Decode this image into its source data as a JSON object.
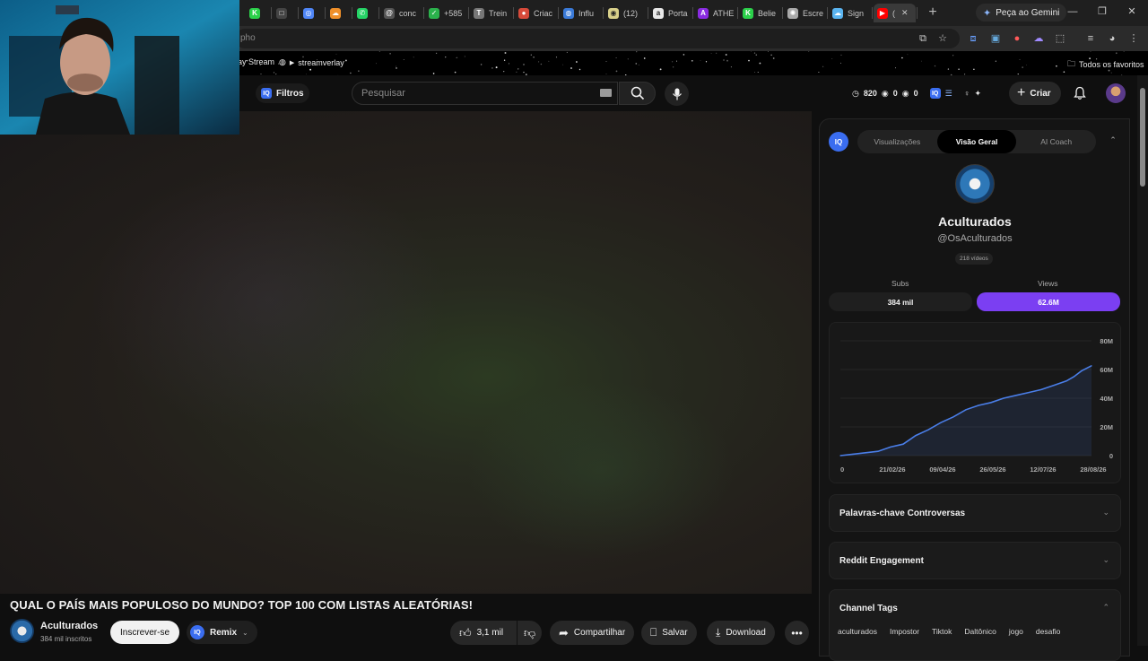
{
  "browser": {
    "tabs": [
      {
        "label": "",
        "icon": "kiwi-icon",
        "color": "#2bd14a",
        "glyph": "K"
      },
      {
        "label": "",
        "icon": "app-icon",
        "color": "#444444",
        "glyph": "□"
      },
      {
        "label": "",
        "icon": "globe-icon",
        "color": "#4f86f7",
        "glyph": "◎"
      },
      {
        "label": "",
        "icon": "cloud-icon",
        "color": "#f0902a",
        "glyph": "☁"
      },
      {
        "label": "",
        "icon": "whatsapp-icon",
        "color": "#25d366",
        "glyph": "✆"
      },
      {
        "label": "conc",
        "icon": "threads-icon",
        "color": "#555555",
        "glyph": "@"
      },
      {
        "label": "+585",
        "icon": "check-icon",
        "color": "#2bb24c",
        "glyph": "✓"
      },
      {
        "label": "Trein",
        "icon": "doc-icon",
        "color": "#777777",
        "glyph": "T"
      },
      {
        "label": "Criac",
        "icon": "record-icon",
        "color": "#d84a3a",
        "glyph": "●"
      },
      {
        "label": "Influ",
        "icon": "globe-icon",
        "color": "#3a7ad8",
        "glyph": "◍"
      },
      {
        "label": "(12)",
        "icon": "chat-icon",
        "color": "#d8d08a",
        "glyph": "◉"
      },
      {
        "label": "Porta",
        "icon": "amazon-icon",
        "color": "#e8e8e8",
        "glyph": "a"
      },
      {
        "label": "ATHE",
        "icon": "athena-icon",
        "color": "#8a2be2",
        "glyph": "A"
      },
      {
        "label": "Belie",
        "icon": "kiwi-icon",
        "color": "#2bd14a",
        "glyph": "K"
      },
      {
        "label": "Escre",
        "icon": "openai-icon",
        "color": "#aaaaaa",
        "glyph": "✺"
      },
      {
        "label": "Sign",
        "icon": "cloud-icon",
        "color": "#5ab4f0",
        "glyph": "☁"
      },
      {
        "label": "(",
        "icon": "youtube-icon",
        "color": "#ff0000",
        "glyph": "▶"
      }
    ],
    "gemini_label": "Peça ao Gemini",
    "omnibox_text": "pho",
    "bookmarks": {
      "stream": "ay Stream",
      "streamverlay": "streamverlay",
      "all": "Todos os favoritos"
    }
  },
  "youtube": {
    "filters_label": "Filtros",
    "search_placeholder": "Pesquisar",
    "stats": {
      "views": "820",
      "a": "0",
      "b": "0"
    },
    "create_label": "Criar"
  },
  "video": {
    "title": "QUAL O PAÍS MAIS POPULOSO DO MUNDO? TOP 100 COM LISTAS ALEATÓRIAS!",
    "channel": "Aculturados",
    "subs": "384 mil inscritos",
    "subscribe": "Inscrever-se",
    "remix": "Remix",
    "likes": "3,1 mil",
    "share": "Compartilhar",
    "save": "Salvar",
    "download": "Download"
  },
  "panel": {
    "tabs": [
      "Visualizações",
      "Visão Geral",
      "AI Coach"
    ],
    "active_tab": 1,
    "channel_name": "Aculturados",
    "handle": "@OsAculturados",
    "videos": "218 vídeos",
    "subs_label": "Subs",
    "subs_value": "384 mil",
    "views_label": "Views",
    "views_value": "62.6M",
    "accent": "#7b3ff2",
    "sections": {
      "keywords": "Palavras-chave Controversas",
      "reddit": "Reddit Engagement",
      "tags": "Channel Tags"
    },
    "tags": [
      "aculturados",
      "Impostor",
      "Tiktok",
      "Daltônico",
      "jogo",
      "desafio"
    ]
  },
  "chart_data": {
    "type": "area",
    "x_tick_labels": [
      "0",
      "21/02/26",
      "09/04/26",
      "26/05/26",
      "12/07/26",
      "28/08/26"
    ],
    "y_tick_labels": [
      "0",
      "20M",
      "40M",
      "60M",
      "80M"
    ],
    "ylim": [
      0,
      80
    ],
    "x": [
      0,
      0.05,
      0.1,
      0.15,
      0.2,
      0.25,
      0.3,
      0.35,
      0.4,
      0.45,
      0.5,
      0.55,
      0.6,
      0.65,
      0.7,
      0.75,
      0.8,
      0.85,
      0.9,
      0.93,
      0.96,
      1.0
    ],
    "values": [
      0,
      1,
      2,
      3,
      6,
      8,
      14,
      18,
      23,
      27,
      32,
      35,
      37,
      40,
      42,
      44,
      46,
      49,
      52,
      55,
      59,
      62.6
    ],
    "color": "#4a7ee8"
  }
}
